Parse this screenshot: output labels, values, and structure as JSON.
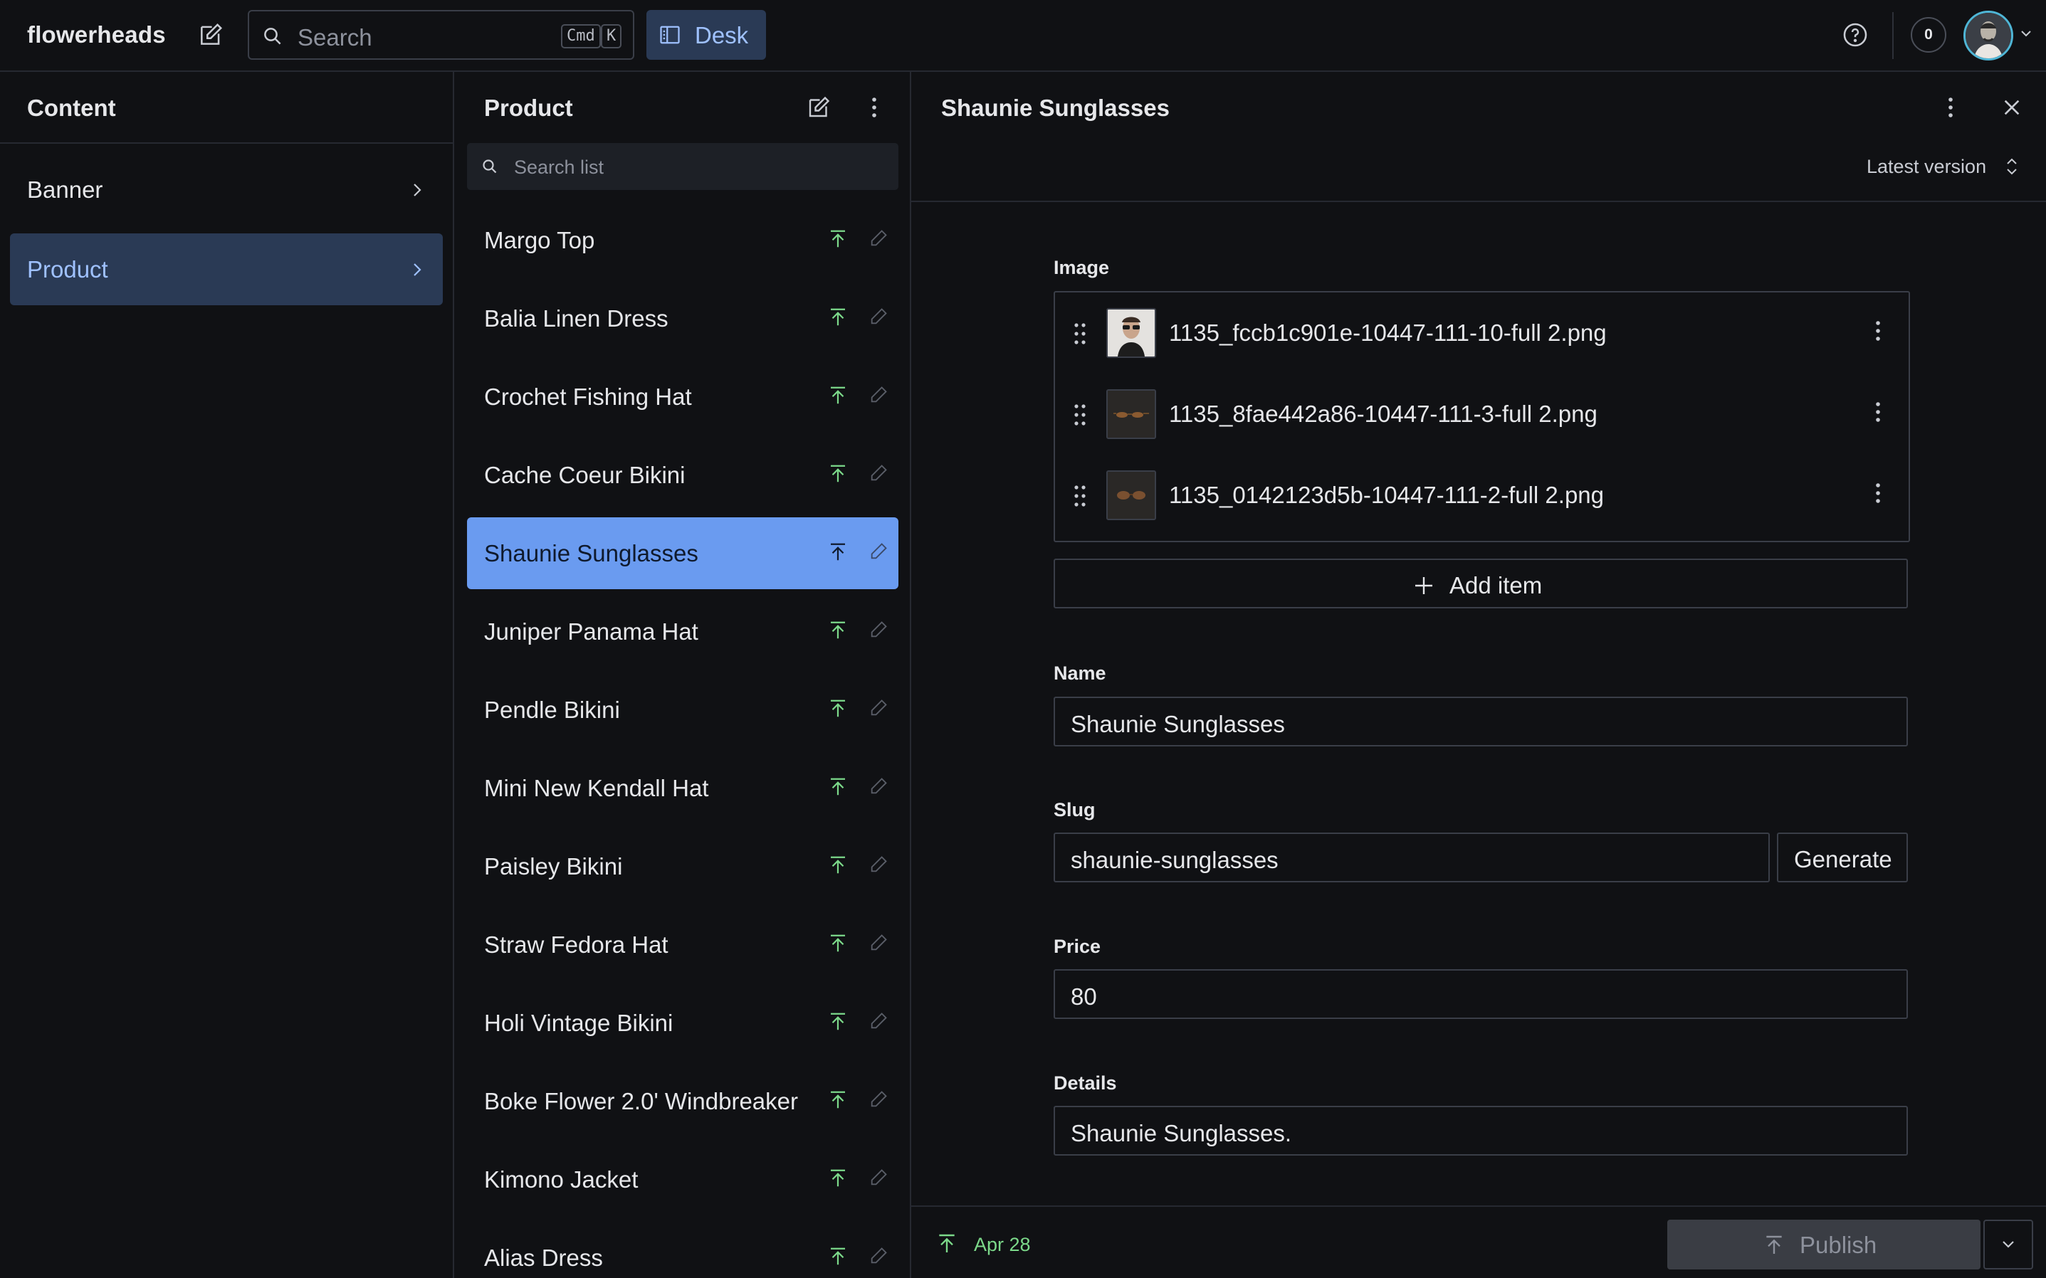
{
  "app": {
    "brand": "flowerheads"
  },
  "topbar": {
    "search_placeholder": "Search",
    "shortcut_cmd": "Cmd",
    "shortcut_key": "K",
    "desk_label": "Desk",
    "notification_count": "0"
  },
  "content_pane": {
    "title": "Content",
    "items": [
      {
        "label": "Banner",
        "active": false
      },
      {
        "label": "Product",
        "active": true
      }
    ]
  },
  "list_pane": {
    "title": "Product",
    "search_placeholder": "Search list",
    "documents": [
      {
        "label": "Margo Top"
      },
      {
        "label": "Balia Linen Dress"
      },
      {
        "label": "Crochet Fishing Hat"
      },
      {
        "label": "Cache Coeur Bikini"
      },
      {
        "label": "Shaunie Sunglasses",
        "active": true
      },
      {
        "label": "Juniper Panama Hat"
      },
      {
        "label": "Pendle Bikini"
      },
      {
        "label": "Mini New Kendall Hat"
      },
      {
        "label": "Paisley Bikini"
      },
      {
        "label": "Straw Fedora Hat"
      },
      {
        "label": "Holi Vintage Bikini"
      },
      {
        "label": "Boke Flower 2.0' Windbreaker"
      },
      {
        "label": "Kimono Jacket"
      },
      {
        "label": "Alias Dress"
      }
    ]
  },
  "document": {
    "title": "Shaunie Sunglasses",
    "version_label": "Latest version",
    "image": {
      "label": "Image",
      "items": [
        {
          "filename": "1135_fccb1c901e-10447-111-10-full 2.png"
        },
        {
          "filename": "1135_8fae442a86-10447-111-3-full 2.png"
        },
        {
          "filename": "1135_0142123d5b-10447-111-2-full 2.png"
        }
      ],
      "add_label": "Add item"
    },
    "name": {
      "label": "Name",
      "value": "Shaunie Sunglasses"
    },
    "slug": {
      "label": "Slug",
      "value": "shaunie-sunglasses",
      "generate_label": "Generate"
    },
    "price": {
      "label": "Price",
      "value": "80"
    },
    "details": {
      "label": "Details",
      "value": "Shaunie Sunglasses."
    },
    "footer": {
      "published_date": "Apr 28",
      "publish_label": "Publish"
    }
  },
  "colors": {
    "background": "#101114",
    "accent_active_bg": "#2a3a55",
    "accent_active_text": "#9fc1ff",
    "selected_row": "#6a9bf0",
    "published_green": "#7cd98a"
  },
  "icons": {
    "compose": "compose-icon",
    "search": "search-icon",
    "desk": "desk-icon",
    "help": "help-icon",
    "chevron_right": "chevron-right-icon",
    "publish": "publish-arrow-icon",
    "edit": "pencil-icon",
    "drag": "drag-handle-icon",
    "menu": "kebab-menu-icon",
    "close": "close-icon",
    "plus": "plus-icon",
    "sort": "up-down-chevron-icon"
  }
}
